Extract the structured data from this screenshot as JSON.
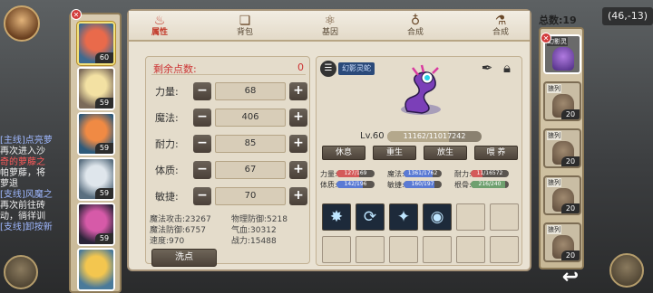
{
  "background": {
    "coords": "(46,-13)",
    "quest_lines": [
      {
        "text": "[主线]点亮萝",
        "kind": "q"
      },
      {
        "text": "再次进入沙",
        "kind": "n"
      },
      {
        "text": "奇的萝藤之",
        "kind": "hl"
      },
      {
        "text": "帕萝藤，将",
        "kind": "n"
      },
      {
        "text": "萝退",
        "kind": "n"
      },
      {
        "text": "[支线]风魔之",
        "kind": "q"
      },
      {
        "text": "再次前往砖",
        "kind": "n"
      },
      {
        "text": "动，徜徉训",
        "kind": "n"
      },
      {
        "text": "[支线]卸按新",
        "kind": "q"
      }
    ]
  },
  "header": {
    "total_label": "总数:",
    "total_value": "19"
  },
  "tabs": [
    {
      "label": "属性",
      "icon": "flame-icon",
      "glyph": "♨",
      "active": true
    },
    {
      "label": "背包",
      "icon": "book-icon",
      "glyph": "❏",
      "active": false
    },
    {
      "label": "基因",
      "icon": "gene-icon",
      "glyph": "⚛",
      "active": false
    },
    {
      "label": "合成",
      "icon": "cauldron-icon",
      "glyph": "♁",
      "active": false
    },
    {
      "label": "合成",
      "icon": "pot-icon",
      "glyph": "⚗",
      "active": false
    }
  ],
  "heroes": [
    {
      "level": "60",
      "selected": true,
      "colors": [
        "#e96a4b",
        "#3e6a8f"
      ]
    },
    {
      "level": "59",
      "selected": false,
      "colors": [
        "#f3e1a3",
        "#7b6a5a"
      ]
    },
    {
      "level": "59",
      "selected": false,
      "colors": [
        "#f08a44",
        "#2e5a7a"
      ]
    },
    {
      "level": "59",
      "selected": false,
      "colors": [
        "#dfe6ec",
        "#5a6f80"
      ]
    },
    {
      "level": "59",
      "selected": false,
      "colors": [
        "#d65aa8",
        "#2b2438"
      ]
    },
    {
      "level": "",
      "selected": false,
      "colors": [
        "#f3c64f",
        "#4a7a9a"
      ]
    }
  ],
  "attributes": {
    "remaining_label": "剩余点数:",
    "remaining_value": "0",
    "stats": [
      {
        "name": "力量:",
        "value": "68"
      },
      {
        "name": "魔法:",
        "value": "406"
      },
      {
        "name": "耐力:",
        "value": "85"
      },
      {
        "name": "体质:",
        "value": "67"
      },
      {
        "name": "敏捷:",
        "value": "70"
      }
    ],
    "derived": [
      {
        "label": "魔法攻击:",
        "value": "23267"
      },
      {
        "label": "物理防御:",
        "value": "5218"
      },
      {
        "label": "魔法防御:",
        "value": "6757"
      },
      {
        "label": "气血:",
        "value": "30312"
      },
      {
        "label": "速度:",
        "value": "970"
      },
      {
        "label": "战力:",
        "value": "15488"
      }
    ],
    "wash_label": "洗点"
  },
  "pet": {
    "name": "幻影灵蛇",
    "level": "Lv.60",
    "exp": "11162/11017242",
    "exp_ratio": 0.65,
    "actions": [
      "休息",
      "重生",
      "放生",
      "喂 养"
    ],
    "stats": [
      {
        "label": "力量:",
        "value": "127/169",
        "fill": 0.6,
        "color": "#d45a5a"
      },
      {
        "label": "魔法:",
        "value": "1361/1762",
        "fill": 0.75,
        "color": "#5a7ad4"
      },
      {
        "label": "耐力:",
        "value": "11/16572",
        "fill": 0.3,
        "color": "#d45a5a"
      },
      {
        "label": "体质:",
        "value": "142/196",
        "fill": 0.7,
        "color": "#5a7ad4"
      },
      {
        "label": "敏捷:",
        "value": "160/197",
        "fill": 0.8,
        "color": "#5a7ad4"
      },
      {
        "label": "根骨:",
        "value": "216/240",
        "fill": 0.9,
        "color": "#6fa06f"
      }
    ],
    "skills": [
      {
        "icon": "frost-burst-icon",
        "glyph": "✸"
      },
      {
        "icon": "whirlwind-icon",
        "glyph": "⟳"
      },
      {
        "icon": "ice-shard-icon",
        "glyph": "✦"
      },
      {
        "icon": "vortex-icon",
        "glyph": "◉"
      },
      {
        "icon": "",
        "glyph": ""
      },
      {
        "icon": "",
        "glyph": ""
      },
      {
        "icon": "",
        "glyph": ""
      },
      {
        "icon": "",
        "glyph": ""
      },
      {
        "icon": "",
        "glyph": ""
      },
      {
        "icon": "",
        "glyph": ""
      },
      {
        "icon": "",
        "glyph": ""
      },
      {
        "icon": "",
        "glyph": ""
      }
    ]
  },
  "pet_list": [
    {
      "tag": "幻影灵",
      "level": "",
      "selected": true
    },
    {
      "tag": "狼列",
      "level": "20",
      "selected": false
    },
    {
      "tag": "狼列",
      "level": "20",
      "selected": false
    },
    {
      "tag": "狼列",
      "level": "20",
      "selected": false
    },
    {
      "tag": "狼列",
      "level": "20",
      "selected": false
    }
  ]
}
